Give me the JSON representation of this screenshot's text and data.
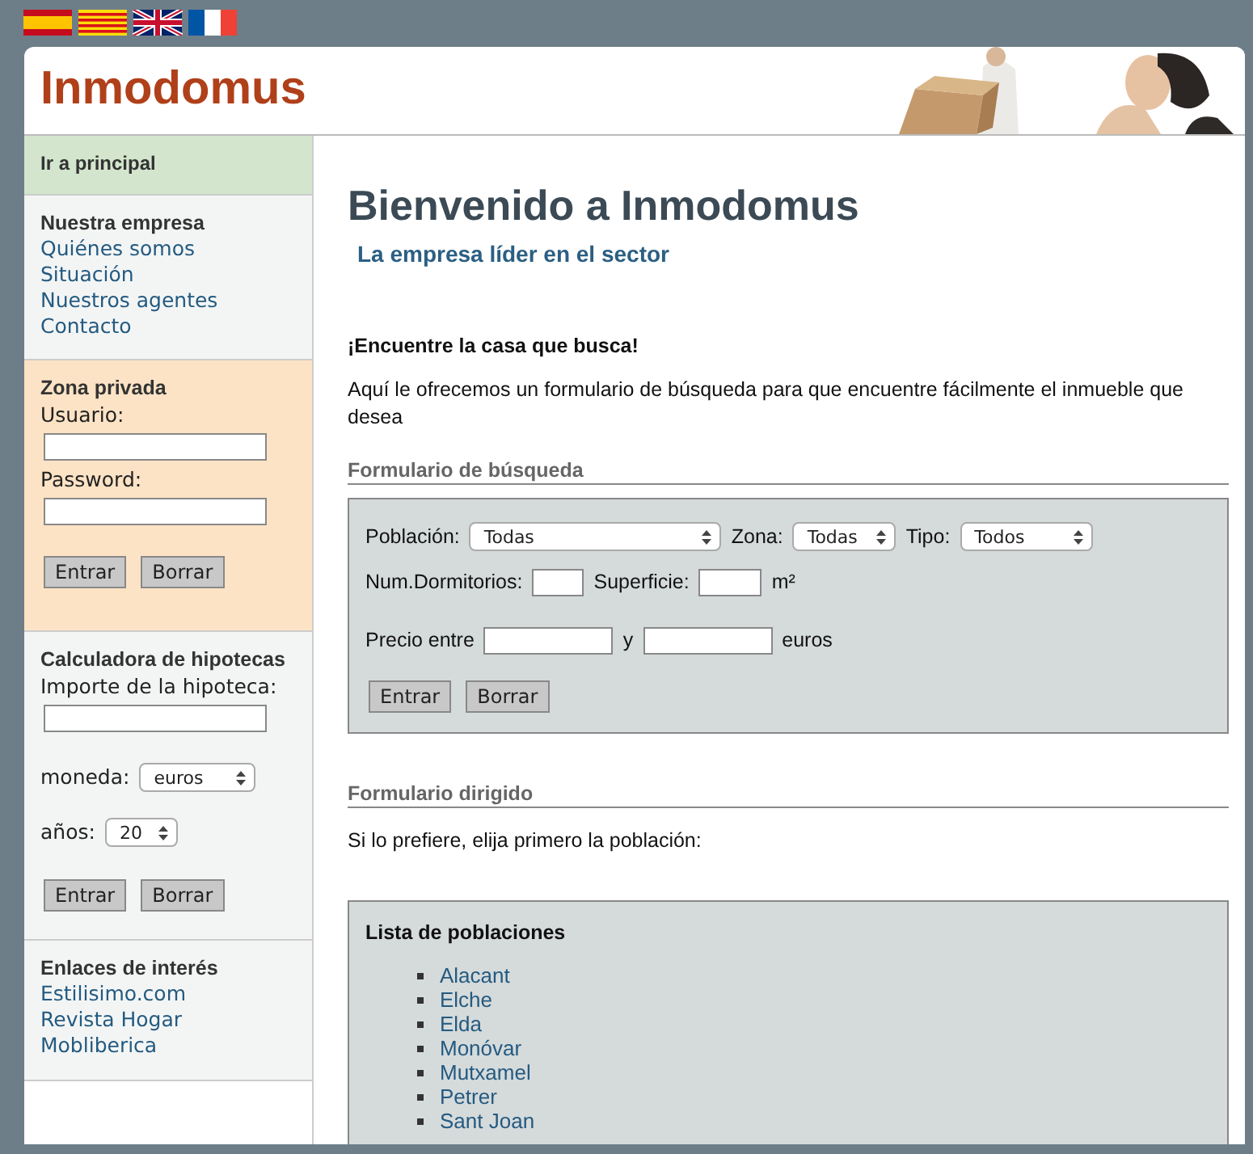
{
  "language_flags": [
    {
      "kind": "spain"
    },
    {
      "kind": "catalonia"
    },
    {
      "kind": "uk"
    },
    {
      "kind": "france"
    }
  ],
  "header": {
    "logo": "Inmodomus"
  },
  "sidebar": {
    "home_link": "Ir a principal",
    "company": {
      "title": "Nuestra empresa",
      "links": [
        "Quiénes somos",
        "Situación",
        "Nuestros agentes",
        "Contacto"
      ]
    },
    "login": {
      "title": "Zona privada",
      "user_label": "Usuario:",
      "password_label": "Password:",
      "buttons": [
        "Entrar",
        "Borrar"
      ]
    },
    "calculator": {
      "title": "Calculadora de hipotecas",
      "amount_label": "Importe de la hipoteca:",
      "currency_label": "moneda:",
      "currency_value": "euros",
      "years_label": "años:",
      "years_value": "20",
      "buttons": [
        "Entrar",
        "Borrar"
      ]
    },
    "links": {
      "title": "Enlaces de interés",
      "items": [
        "Estilisimo.com",
        "Revista Hogar",
        "Mobliberica"
      ]
    }
  },
  "main": {
    "title": "Bienvenido a Inmodomus",
    "subtitle": "La empresa líder en el sector",
    "lead": "¡Encuentre la casa que busca!",
    "intro": "Aquí le ofrecemos un formulario de búsqueda para que encuentre fácilmente el inmueble que desea",
    "search_form": {
      "heading": "Formulario de búsqueda",
      "population_label": "Población:",
      "population_value": "Todas",
      "zone_label": "Zona:",
      "zone_value": "Todas",
      "type_label": "Tipo:",
      "type_value": "Todos",
      "bedrooms_label": "Num.Dormitorios:",
      "surface_label": "Superficie:",
      "surface_unit": "m²",
      "price_label": "Precio entre",
      "price_and": "y",
      "price_unit": "euros",
      "buttons": [
        "Entrar",
        "Borrar"
      ]
    },
    "directed_form": {
      "heading": "Formulario dirigido",
      "text": "Si lo prefiere, elija primero la población:",
      "list_title": "Lista de poblaciones",
      "towns": [
        "Alacant",
        "Elche",
        "Elda",
        "Monóvar",
        "Mutxamel",
        "Petrer",
        "Sant Joan"
      ]
    }
  }
}
